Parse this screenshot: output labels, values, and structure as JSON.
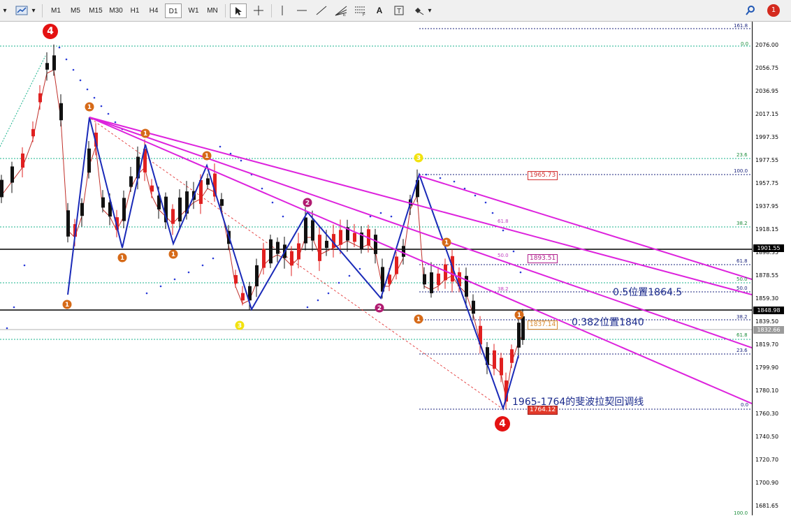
{
  "toolbar": {
    "timeframes": [
      {
        "label": "M1",
        "selected": false
      },
      {
        "label": "M5",
        "selected": false
      },
      {
        "label": "M15",
        "selected": false
      },
      {
        "label": "M30",
        "selected": false
      },
      {
        "label": "H1",
        "selected": false
      },
      {
        "label": "H4",
        "selected": false
      },
      {
        "label": "D1",
        "selected": true
      },
      {
        "label": "W1",
        "selected": false
      },
      {
        "label": "MN",
        "selected": false
      }
    ],
    "tools": [
      "cursor-icon",
      "crosshair-icon",
      "vertical-line-icon",
      "horizontal-line-icon",
      "trendline-icon",
      "fibonacci-fan-icon",
      "fibonacci-levels-icon",
      "text-icon",
      "text-label-icon",
      "shapes-icon"
    ],
    "text_tool_label": "A",
    "notification_count": "1",
    "colors": {
      "accent": "#1e56b4",
      "notification": "#d42a1e"
    }
  },
  "price_axis": {
    "ticks": [
      "2076.00",
      "2056.75",
      "2036.95",
      "2017.15",
      "1997.35",
      "1977.55",
      "1957.75",
      "1937.95",
      "1918.15",
      "1898.35",
      "1878.55",
      "1859.30",
      "1839.50",
      "1819.70",
      "1799.90",
      "1780.10",
      "1760.30",
      "1740.50",
      "1720.70",
      "1700.90",
      "1681.65"
    ],
    "highlight_prices": [
      {
        "label": "1901.55",
        "style": "black"
      },
      {
        "label": "1848.98",
        "style": "black"
      },
      {
        "label": "1832.66",
        "style": "grey"
      }
    ]
  },
  "fib_labels": {
    "right_top": [
      "161.8",
      "0.0",
      "23.6",
      "100.0",
      "38.2",
      "61.8",
      "50.0",
      "50.0",
      "38.2",
      "61.8",
      "23.6",
      "0.0",
      "100.0"
    ],
    "middle": [
      "61.8",
      "50.0",
      "38.2"
    ]
  },
  "price_boxes": [
    {
      "label": "1965.73",
      "color": "#d23232"
    },
    {
      "label": "1893.51",
      "color": "#b0208c"
    },
    {
      "label": "1837.14",
      "color": "#d98a2c"
    },
    {
      "label": "1764.12",
      "color": "#d23232"
    }
  ],
  "wave_labels": {
    "top_left_4": "4",
    "bottom_4": "4",
    "yellow_3_bottom": "3",
    "yellow_3_top": "3",
    "purple_2": [
      "2",
      "2"
    ],
    "orange_1": [
      "1",
      "1",
      "1",
      "1",
      "1",
      "1",
      "1",
      "1",
      "1"
    ]
  },
  "annotations": {
    "half": "0.5位置1864.5",
    "fib382": "0.382位置1840",
    "fib_title": "1965-1764的斐波拉契回调线"
  },
  "chart_data": {
    "type": "candlestick",
    "timeframe": "D1",
    "ylim": [
      1676,
      2088
    ],
    "key_levels": {
      "swing_high": 1965.73,
      "swing_low": 1764.12,
      "fib_0_5": 1864.5,
      "fib_0_382": 1840,
      "current": 1832.66,
      "resistance_1": 1901.55,
      "resistance_2": 1848.98
    }
  }
}
